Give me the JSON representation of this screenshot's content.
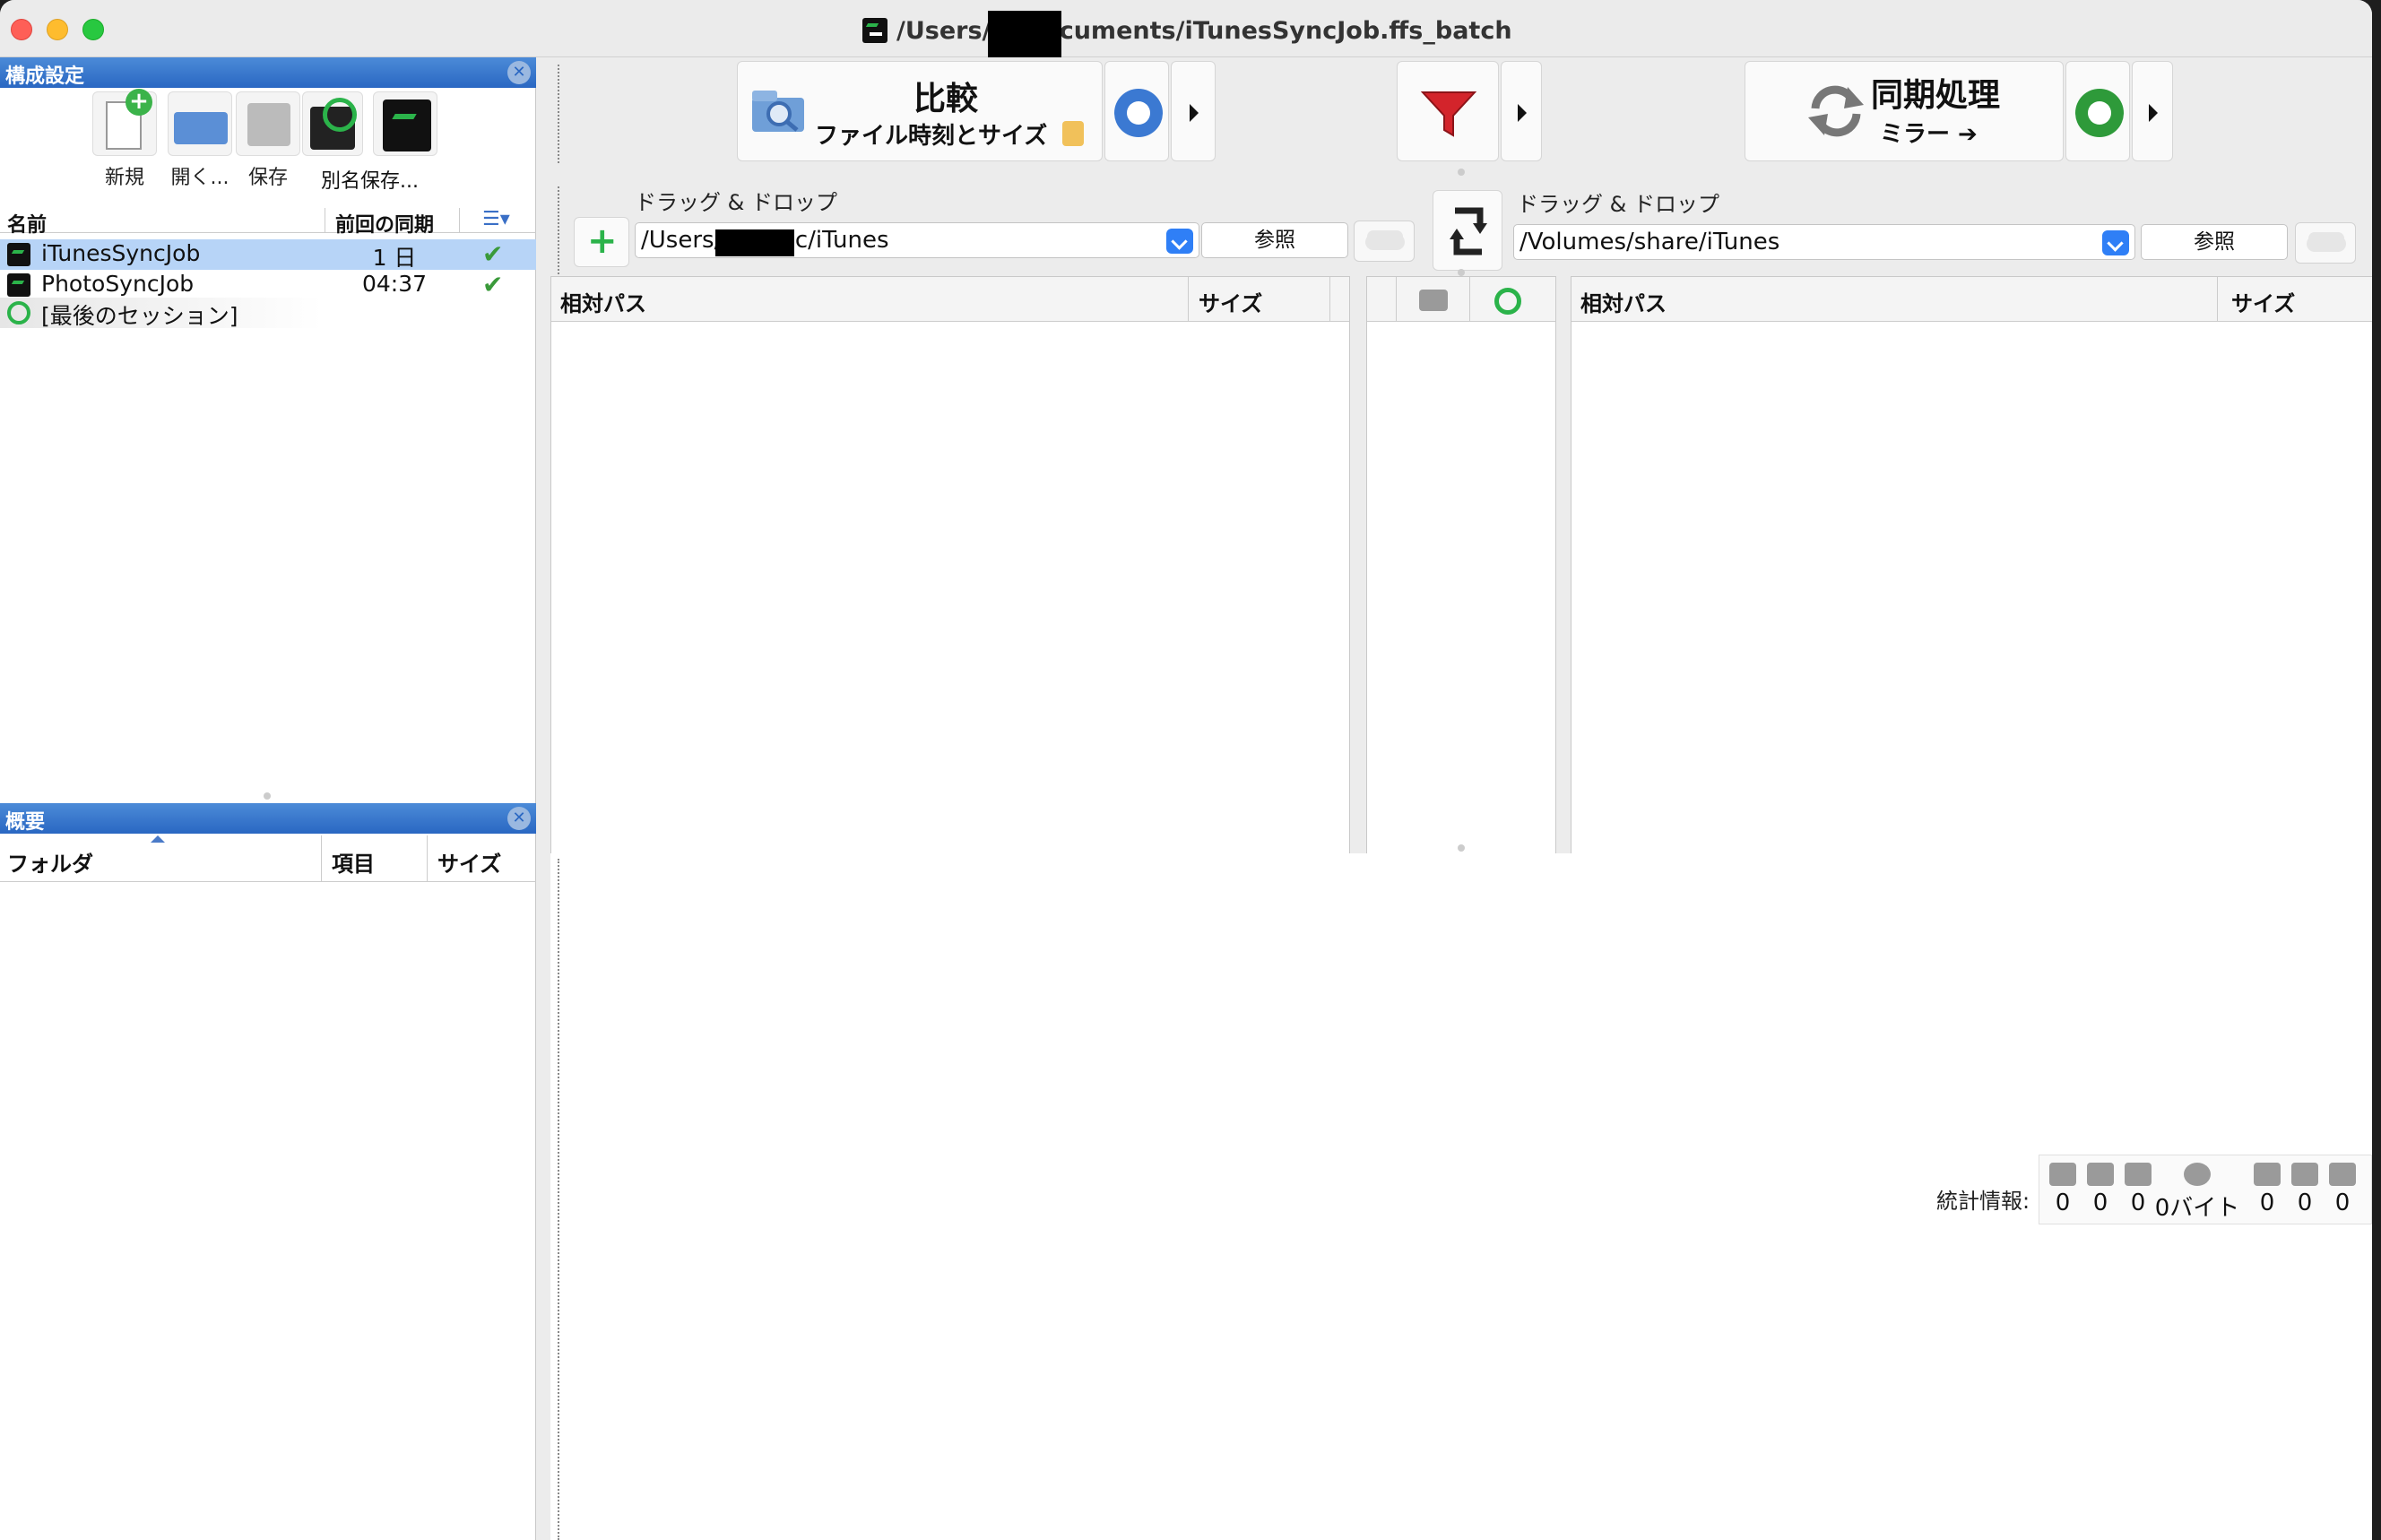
{
  "window": {
    "title": "/Users/s      /Documents/iTunesSyncJob.ffs_batch"
  },
  "config_panel": {
    "title": "構成設定",
    "tools": {
      "new": "新規",
      "open": "開く...",
      "save": "保存",
      "save_as": "別名保存..."
    },
    "columns": {
      "name": "名前",
      "last_sync": "前回の同期"
    },
    "rows": [
      {
        "name": "iTunesSyncJob",
        "last_sync": "1 日",
        "ok": true
      },
      {
        "name": "PhotoSyncJob",
        "last_sync": "04:37",
        "ok": true
      },
      {
        "name": "[最後のセッション]",
        "last_sync": "",
        "ok": false
      }
    ]
  },
  "overview_panel": {
    "title": "概要",
    "columns": {
      "folder": "フォルダ",
      "items": "項目",
      "size": "サイズ"
    }
  },
  "toolbar": {
    "compare_label": "比較",
    "compare_mode": "ファイル時刻とサイズ",
    "sync_label": "同期処理",
    "sync_mode": "ミラー ➔"
  },
  "left_folder": {
    "drop_label": "ドラッグ & ドロップ",
    "path": "/Users/s      Music/iTunes",
    "browse": "参照"
  },
  "right_folder": {
    "drop_label": "ドラッグ & ドロップ",
    "path": "/Volumes/share/iTunes",
    "browse": "参照"
  },
  "grid": {
    "left_cols": {
      "rel_path": "相対パス",
      "size": "サイズ"
    },
    "right_cols": {
      "rel_path": "相対パス",
      "size": "サイズ"
    }
  },
  "stats": {
    "label": "統計情報:",
    "values": [
      "0",
      "0",
      "0",
      "0",
      "0",
      "0",
      "0"
    ],
    "bytes_unit": "バイト"
  }
}
